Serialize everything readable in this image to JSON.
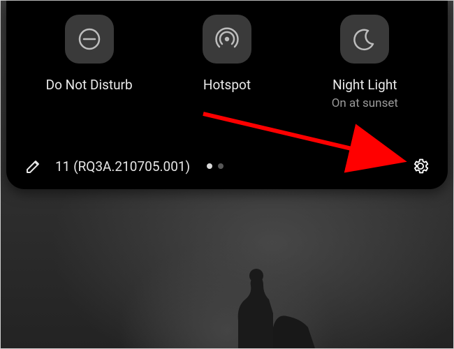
{
  "quick_settings": {
    "tiles": [
      {
        "label": "Do Not Disturb",
        "sublabel": "",
        "icon": "dnd-icon"
      },
      {
        "label": "Hotspot",
        "sublabel": "",
        "icon": "hotspot-icon"
      },
      {
        "label": "Night Light",
        "sublabel": "On at sunset",
        "icon": "night-light-icon"
      }
    ],
    "build_text": "11 (RQ3A.210705.001)",
    "page_indicator": {
      "total": 2,
      "active_index": 0
    }
  },
  "annotation": {
    "type": "arrow",
    "color": "#ff0000"
  }
}
